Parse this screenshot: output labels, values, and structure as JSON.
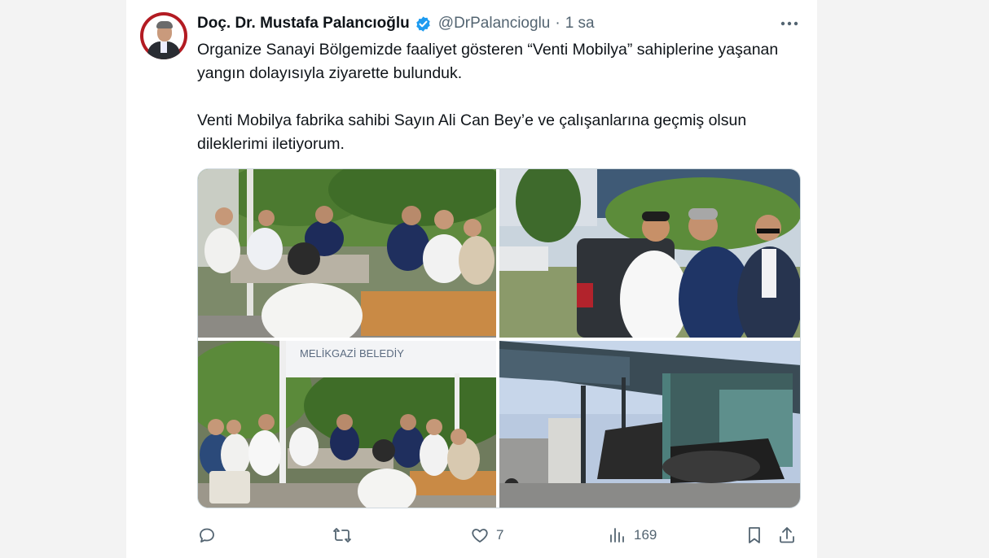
{
  "tweet": {
    "author_name": "Doç. Dr. Mustafa Palancıoğlu",
    "handle": "@DrPalancioglu",
    "separator": "·",
    "time": "1 sa",
    "paragraph1": "Organize Sanayi Bölgemizde faaliyet gösteren “Venti Mobilya”  sahiplerine yaşanan yangın dolayısıyla ziyarette bulunduk.",
    "paragraph2": "Venti Mobilya fabrika sahibi Sayın Ali Can Bey’e ve çalışanlarına geçmiş olsun dileklerimi iletiyorum.",
    "photo_sign_text": "MELİKGAZİ BELEDİY"
  },
  "actions": {
    "reply_count": "",
    "retweet_count": "",
    "like_count": "7",
    "view_count": "169"
  },
  "icons": [
    "verified-badge-icon",
    "more-icon",
    "reply-icon",
    "retweet-icon",
    "like-icon",
    "views-icon",
    "bookmark-icon",
    "share-icon"
  ],
  "colors": {
    "verified_blue": "#1d9bf0",
    "muted_text": "#536471",
    "avatar_red": "#b31b22"
  }
}
